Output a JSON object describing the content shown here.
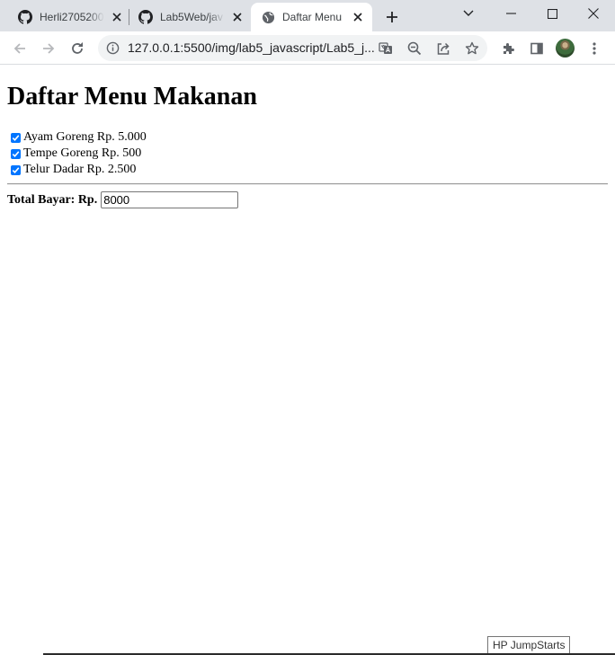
{
  "browser": {
    "tabs": [
      {
        "title": "Herli2705200",
        "icon": "github-icon",
        "active": false
      },
      {
        "title": "Lab5Web/jav",
        "icon": "github-icon",
        "active": false
      },
      {
        "title": "Daftar Menu",
        "icon": "globe-icon",
        "active": true
      }
    ],
    "url": "127.0.0.1:5500/img/lab5_javascript/Lab5_j..."
  },
  "page": {
    "heading": "Daftar Menu Makanan",
    "menu_items": [
      {
        "label": "Ayam Goreng Rp. 5.000",
        "checked": true
      },
      {
        "label": "Tempe Goreng Rp. 500",
        "checked": true
      },
      {
        "label": "Telur Dadar Rp. 2.500",
        "checked": true
      }
    ],
    "total_label": "Total Bayar: Rp.",
    "total_value": "8000"
  },
  "tooltip": "HP JumpStarts",
  "colors": {
    "tabstrip": "#dee1e6",
    "checkbox": "#0075ff",
    "omnibox": "#f1f3f4"
  }
}
